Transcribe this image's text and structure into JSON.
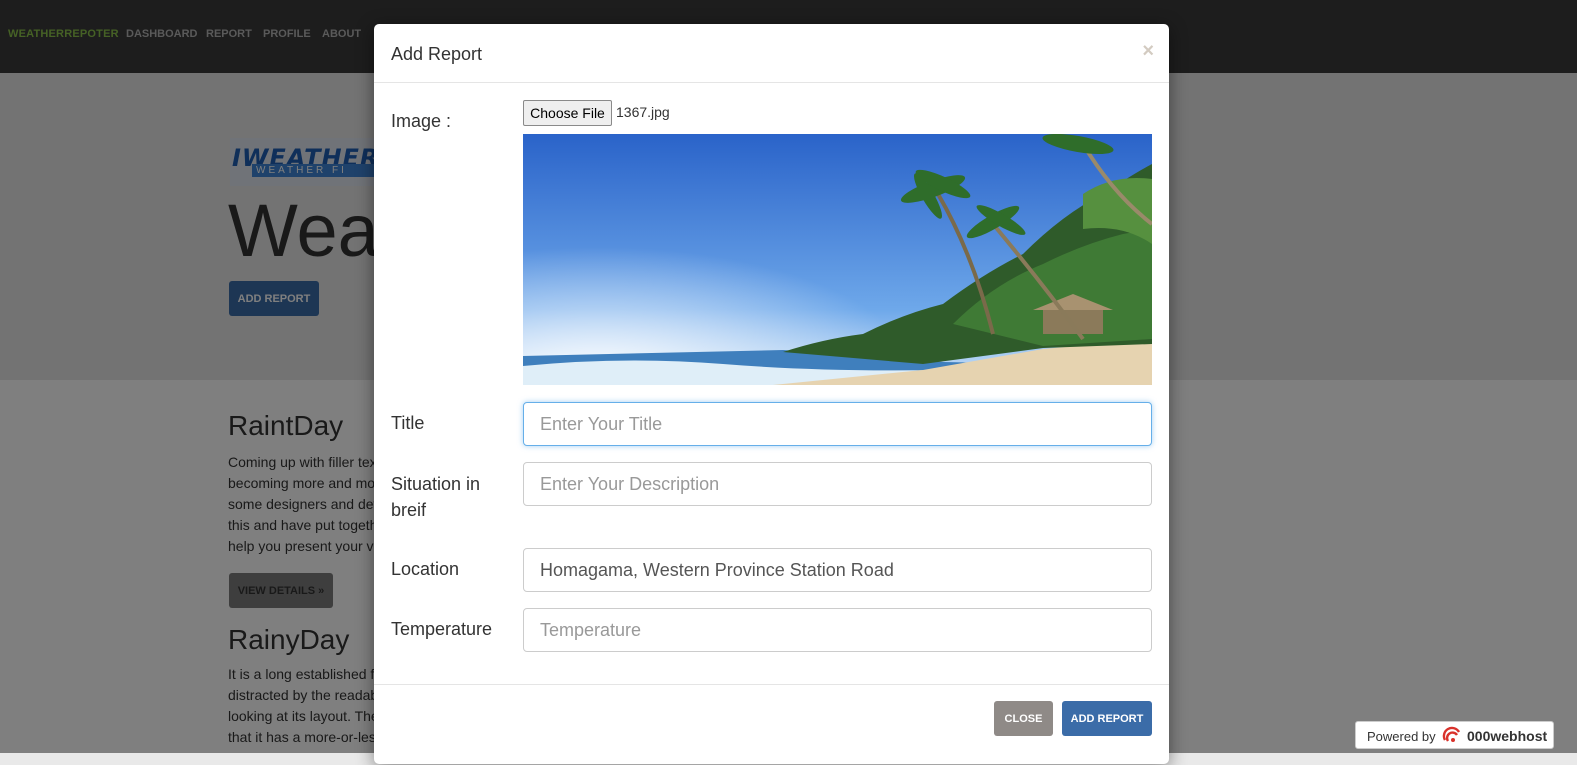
{
  "navbar": {
    "brand": "WEATHERREPOTER",
    "links": [
      "DASHBOARD",
      "REPORT",
      "PROFILE",
      "ABOUT"
    ]
  },
  "hero": {
    "logo_text": "IWEATHER",
    "logo_sub": "WEATHER FI",
    "title": "Weat",
    "add_button": "ADD REPORT"
  },
  "posts": [
    {
      "title": "RaintDay",
      "lines": [
        "Coming up with filler text",
        "becoming more and more",
        "some designers and dev",
        "this and have put togeth",
        "help you present your vi"
      ],
      "button": "VIEW DETAILS »"
    },
    {
      "title": "RainyDay",
      "lines": [
        "It is a long established f",
        "distracted by the readab",
        "looking at its layout. The",
        "that it has a more-or-les"
      ]
    }
  ],
  "modal": {
    "title": "Add Report",
    "close_symbol": "×",
    "image_label": "Image :",
    "file_button": "Choose File",
    "file_name": "1367.jpg",
    "title_label": "Title",
    "title_placeholder": "Enter Your Title",
    "situation_label_1": "Situation in",
    "situation_label_2": "breif",
    "situation_placeholder": "Enter Your Description",
    "location_label": "Location",
    "location_value": "Homagama, Western Province Station Road",
    "temperature_label": "Temperature",
    "temperature_placeholder": "Temperature",
    "close_button": "CLOSE",
    "submit_button": "ADD REPORT"
  },
  "powered": {
    "text": "Powered by",
    "brand": "000webhost"
  },
  "colors": {
    "primary": "#3b6ca8",
    "brand_green": "#8bc34a",
    "navbar_bg": "#3a3a3a"
  }
}
